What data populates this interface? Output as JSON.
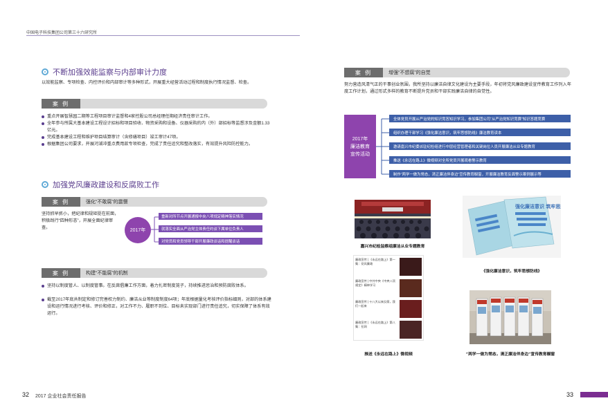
{
  "header": {
    "org": "中国电子科技集团公司第三十六研究所"
  },
  "left": {
    "section1": {
      "title": "不断加强效能监察与内部审计力度",
      "intro": "以效能监察、专项检查、内控评价和内部审计等多种形式，开展重大经营活动过程和制度执行情况监督、检查。",
      "case_label": "案 例",
      "bullets": [
        "重点开展智慧园二期等工程项目审计监督和4家控股公司总经理任期经济责任审计工作。",
        "全年参与所属大基本建设工程设计招标和项目验收、物资采购和设备、仪器采购的内（外）部招标等监督涉及金额1.33亿元。",
        "完成基本建设工程和维护项目结算审计（含修缮项目）竣工审计47项。",
        "根据集团公司要求，开展河湖冲重点费用款专项检查，完成了责任追究和整改落实，有效提升风险防控能力。"
      ]
    },
    "section2": {
      "title": "加强党风廉政建设和反腐败工作",
      "case1": {
        "label": "案 例",
        "title": "强化“不敢腐”的震慑"
      },
      "case1_text": "坚持抓早抓小，把纪律和规矩挺在前面，积极践行“四种形态”，开展全面纪律审查。",
      "year": "2017年",
      "case1_items": [
        "重新对所节点开展通报中央八项规定精神落实情况",
        "就落实全面从严治党主体责任约谈下属单位负责人",
        "对党员和党员领导干部开展廉政谈话和提醒谈话"
      ],
      "case2": {
        "label": "案 例",
        "title": "构建“不能腐”的机制"
      },
      "bullets": [
        "坚持以制度管人、以制度管事。在反腐倡廉工作方面，着力扎密制度笼子，持续推进惩治和预防腐败体系。",
        "截至2017年底共制定和修订完善权力制约、廉洁从业等制度制度64项；年底根据量化考核评价指标细则，对部的体系建设和运行情况进行考核、评价和修正，对工作不力、履职不到位、目标未实现部门进行责任追究，切实保障了体系有效运行。"
      ]
    }
  },
  "right": {
    "case": {
      "label": "案 例",
      "title": "增强“不想腐”的自觉"
    },
    "intro": "努力营造风清气正的干事创业氛围，我所坚持以廉洁自律文化建设为主要手段，年初将党风廉政建设宣传教育工作列入年度工作计划，通过形式多样的教育不断提升党员和干部实践廉洁自律的自觉性。",
    "box_title": [
      "2017年",
      "廉洁教育",
      "宣传活动"
    ],
    "items": [
      "全体党员开展从严治党的知识竞答知识学习，参加集团公司“从严治党知识竞赛”知识答题竞赛",
      "组织办理干部学习《强化廉洁意识，筑牢思想防线》廉洁教育读本",
      "邀请嘉兴市纪委派驻纪检组进行中层经营管理者和关键岗位人员开展廉洁从业专题教育",
      "推送《永远在路上》微视频对全所党员开展观看警示教育",
      "制作“两学一做为常态，清正廉洁伴身边”宣传教育橱窗，开展廉洁教育反面警示案例展示等"
    ],
    "captions": {
      "photo1": "嘉兴市纪检监察组廉洁从业专题教育",
      "photo2": "《强化廉洁意识，筑牢思想防线》",
      "photo3": "推送《永远在路上》微视频",
      "photo4": "“两学一做为常态，清正廉洁伴身边”宣传教育橱窗"
    },
    "phone_items": [
      "廉政宣传 | 《永远在路上》第一集：党风廉政",
      "廉政宣传 | 中共中央《中央八项规定》精神学习",
      "廉政宣传 | 十八大以来反腐，我们一起来",
      "廉政宣传 | 《永远在路上》第八集：拉网"
    ],
    "book_title": "强化廉洁意识 筑牢思想防线"
  },
  "footer": {
    "left_page": "32",
    "left_text": "2017 企业社会责任报告",
    "right_page": "33"
  },
  "colors": {
    "purple": "#7b4fb3",
    "blue": "#3d5fa8",
    "accent": "#8e44ad",
    "gray_dark": "#6d6d6d"
  }
}
